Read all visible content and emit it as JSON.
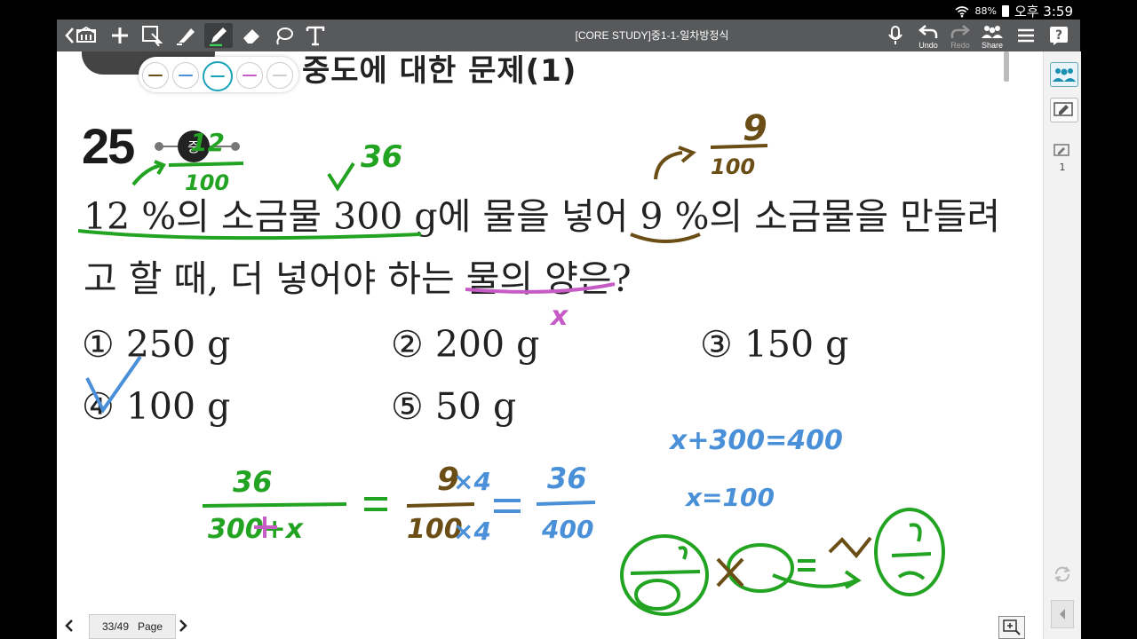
{
  "status": {
    "wifi_icon": "wifi-icon",
    "battery": "88%",
    "time": "오후 3:59"
  },
  "toolbar": {
    "title": "[CORE STUDY]중1-1-일차방정식",
    "undo": "Undo",
    "redo": "Redo",
    "share": "Share"
  },
  "palette": {
    "colors": [
      "#6b4e16",
      "#4a90d9",
      "#1aa3b8",
      "#c65bc6",
      "#cccccc"
    ]
  },
  "problem": {
    "header_text": "중도에 대한 문제(1)",
    "number": "25",
    "difficulty": "중",
    "line1": "12 %의 소금물 300 g에 물을 넣어 9 %의 소금물을 만들려",
    "line2": "고 할 때, 더 넣어야 하는 물의 양은?",
    "choices": [
      {
        "mark": "①",
        "text": "250 g"
      },
      {
        "mark": "②",
        "text": "200 g"
      },
      {
        "mark": "③",
        "text": "150 g"
      },
      {
        "mark": "④",
        "text": "100 g"
      },
      {
        "mark": "⑤",
        "text": "50 g"
      }
    ]
  },
  "handwriting": {
    "frac_12_num": "12",
    "frac_12_den": "100",
    "val_36": "36",
    "frac_9_num": "9",
    "frac_9_den": "100",
    "x_label": "x",
    "eq_left_num": "36",
    "eq_left_den": "300+x",
    "mid_num": "9",
    "mid_den": "100",
    "times4_top": "×4",
    "times4_bot": "×4",
    "right_num": "36",
    "right_den": "400",
    "eq1": "x+300=400",
    "eq2": "x=100"
  },
  "nav": {
    "page_indicator": "33/49",
    "page_label": "Page"
  },
  "sidebar": {
    "page_count": "1"
  }
}
